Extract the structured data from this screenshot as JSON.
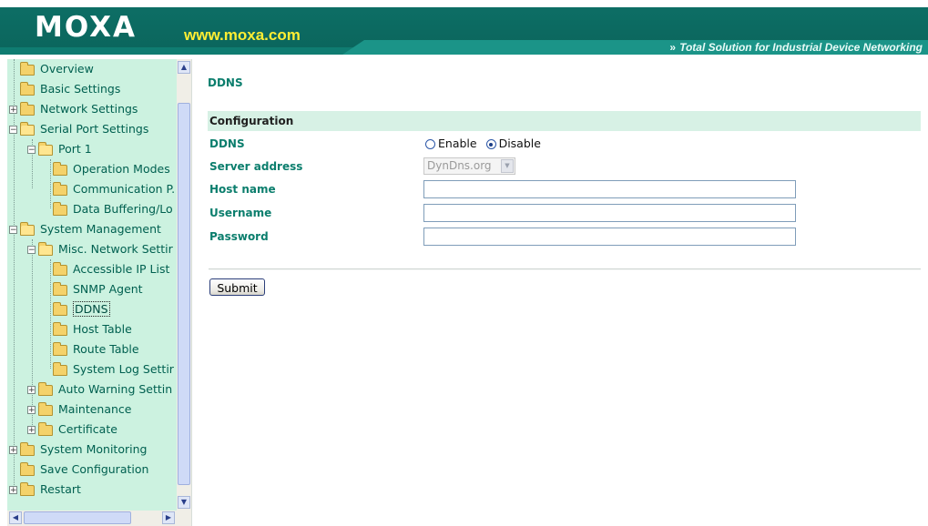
{
  "header": {
    "logo_text": "MOXA",
    "url_text": "www.moxa.com",
    "tagline": "Total Solution for Industrial Device Networking",
    "brand_color": "#0f7c71"
  },
  "sidebar": {
    "items": [
      {
        "label": "Overview",
        "expander": ""
      },
      {
        "label": "Basic Settings",
        "expander": ""
      },
      {
        "label": "Network Settings",
        "expander": "+"
      },
      {
        "label": "Serial Port Settings",
        "expander": "−"
      },
      {
        "label": "Port 1",
        "expander": "−"
      },
      {
        "label": "Operation Modes",
        "expander": ""
      },
      {
        "label": "Communication P.",
        "expander": ""
      },
      {
        "label": "Data Buffering/Lo",
        "expander": ""
      },
      {
        "label": "System Management",
        "expander": "−"
      },
      {
        "label": "Misc. Network Settir",
        "expander": "−"
      },
      {
        "label": "Accessible IP List",
        "expander": ""
      },
      {
        "label": "SNMP Agent",
        "expander": ""
      },
      {
        "label": "DDNS",
        "expander": "",
        "selected": true
      },
      {
        "label": "Host Table",
        "expander": ""
      },
      {
        "label": "Route Table",
        "expander": ""
      },
      {
        "label": "System Log Settir",
        "expander": ""
      },
      {
        "label": "Auto Warning Settin",
        "expander": "+"
      },
      {
        "label": "Maintenance",
        "expander": "+"
      },
      {
        "label": "Certificate",
        "expander": "+"
      },
      {
        "label": "System Monitoring",
        "expander": "+"
      },
      {
        "label": "Save Configuration",
        "expander": ""
      },
      {
        "label": "Restart",
        "expander": "+"
      }
    ]
  },
  "main": {
    "page_title": "DDNS",
    "section_title": "Configuration",
    "fields": {
      "ddns_label": "DDNS",
      "ddns_enable": "Enable",
      "ddns_disable": "Disable",
      "ddns_selected": "Disable",
      "server_label": "Server address",
      "server_value": "DynDns.org",
      "host_label": "Host name",
      "host_value": "",
      "username_label": "Username",
      "username_value": "",
      "password_label": "Password",
      "password_value": ""
    },
    "submit_label": "Submit"
  }
}
